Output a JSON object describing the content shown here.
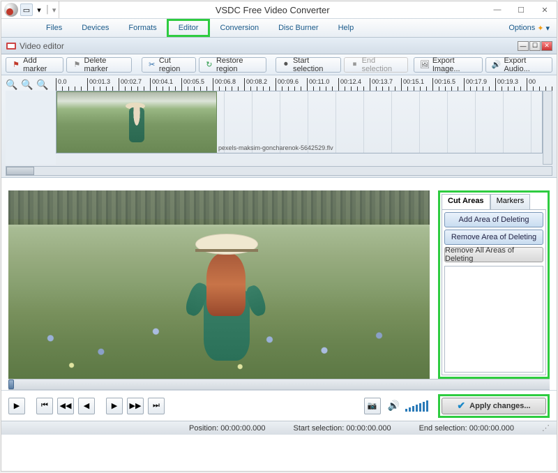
{
  "titlebar": {
    "app_title": "VSDC Free Video Converter"
  },
  "ribbon": {
    "tabs": [
      "Files",
      "Devices",
      "Formats",
      "Editor",
      "Conversion",
      "Disc Burner",
      "Help"
    ],
    "active_index": 3,
    "options_label": "Options"
  },
  "subheader": {
    "title": "Video editor"
  },
  "toolbar": {
    "add_marker": "Add marker",
    "delete_marker": "Delete marker",
    "cut_region": "Cut region",
    "restore_region": "Restore region",
    "start_selection": "Start selection",
    "end_selection": "End selection",
    "export_image": "Export Image...",
    "export_audio": "Export Audio..."
  },
  "timeline": {
    "ticks": [
      "0.0",
      "00:01.3",
      "00:02.7",
      "00:04.1",
      "00:05.5",
      "00:06.8",
      "00:08.2",
      "00:09.6",
      "00:11.0",
      "00:12.4",
      "00:13.7",
      "00:15.1",
      "00:16.5",
      "00:17.9",
      "00:19.3",
      "00"
    ],
    "filename": "pexels-maksim-goncharenok-5642529.flv"
  },
  "side": {
    "tabs": [
      "Cut Areas",
      "Markers"
    ],
    "active_index": 0,
    "add_area": "Add Area of Deleting",
    "remove_area": "Remove Area of Deleting",
    "remove_all": "Remove All Areas of Deleting"
  },
  "apply": {
    "label": "Apply changes..."
  },
  "status": {
    "position_label": "Position:",
    "position_value": "00:00:00.000",
    "start_label": "Start selection:",
    "start_value": "00:00:00.000",
    "end_label": "End selection:",
    "end_value": "00:00:00.000"
  }
}
